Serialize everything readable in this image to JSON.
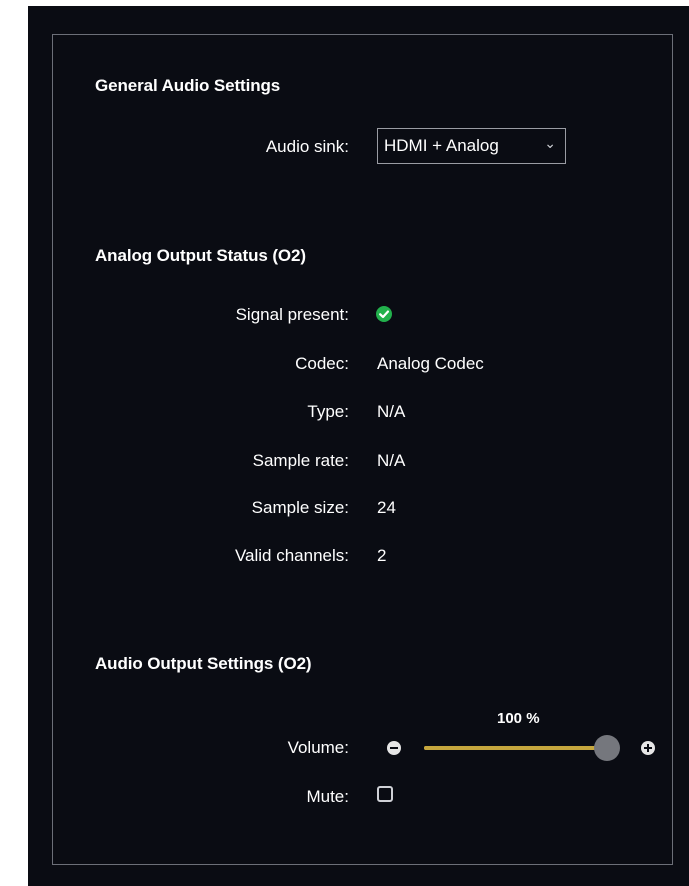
{
  "general_audio": {
    "title": "General Audio Settings",
    "audio_sink_label": "Audio sink:",
    "audio_sink_value": "HDMI + Analog",
    "caret_glyph": "⌄"
  },
  "analog_status": {
    "title": "Analog Output Status (O2)",
    "rows": [
      {
        "label": "Signal present:",
        "value": null,
        "icon": "check-circle-icon",
        "icon_color": "#22b14c"
      },
      {
        "label": "Codec:",
        "value": "Analog Codec"
      },
      {
        "label": "Type:",
        "value": "N/A"
      },
      {
        "label": "Sample rate:",
        "value": "N/A"
      },
      {
        "label": "Sample size:",
        "value": "24"
      },
      {
        "label": "Valid channels:",
        "value": "2"
      }
    ]
  },
  "audio_output": {
    "title": "Audio Output Settings (O2)",
    "volume_label": "Volume:",
    "volume_display": "100 %",
    "volume_fraction": 1.0,
    "mute_label": "Mute:",
    "mute_checked": false
  },
  "colors": {
    "background": "#0a0c13",
    "accent": "#c6a73e",
    "success": "#22b14c",
    "border": "#6c6f78"
  }
}
